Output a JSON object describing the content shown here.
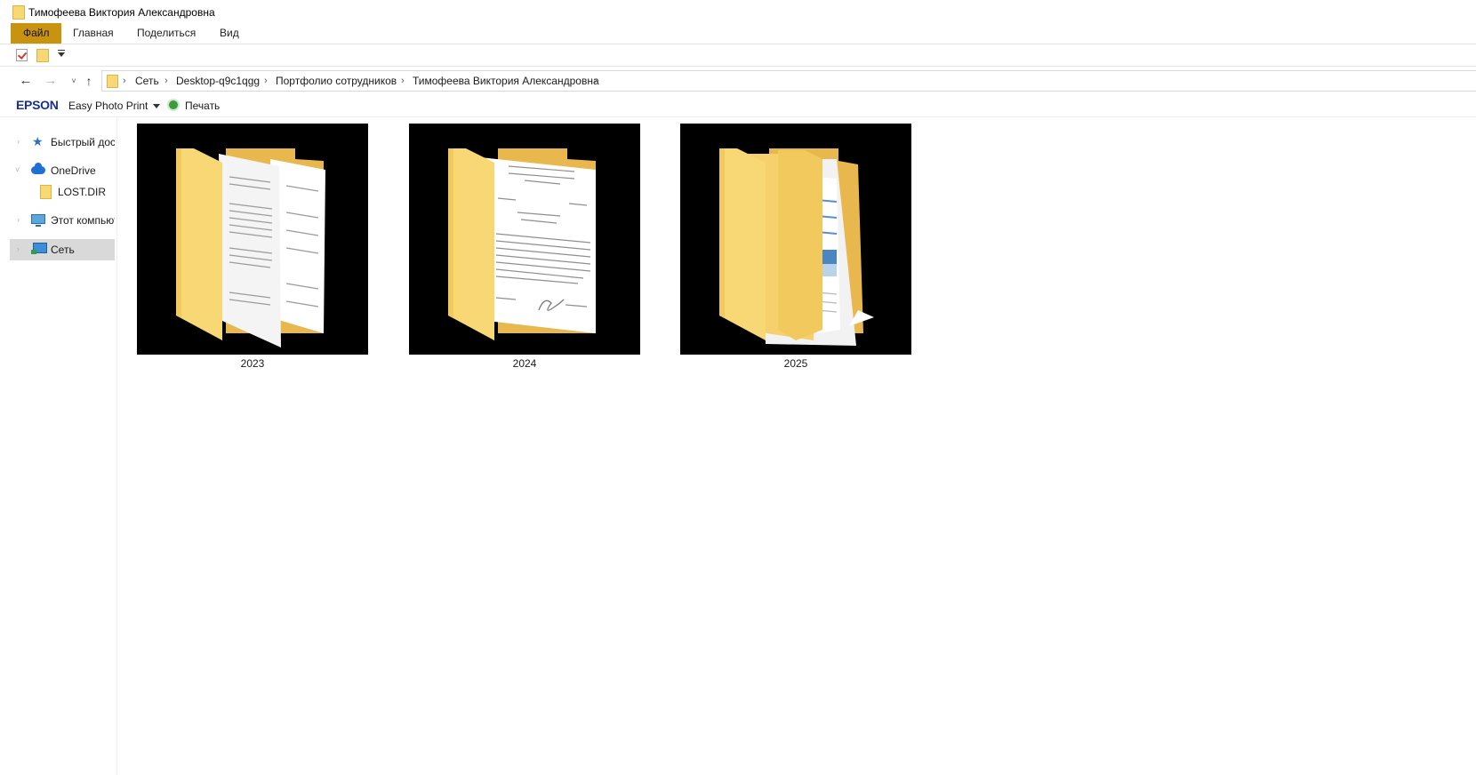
{
  "window": {
    "title": "Тимофеева Виктория Александровна"
  },
  "ribbon": {
    "tabs": [
      {
        "label": "Файл",
        "active": true
      },
      {
        "label": "Главная"
      },
      {
        "label": "Поделиться"
      },
      {
        "label": "Вид"
      }
    ]
  },
  "navigation": {
    "back": "←",
    "forward": "→",
    "recent": "˅",
    "up": "↑"
  },
  "address": {
    "breadcrumbs": [
      "Сеть",
      "Desktop-q9c1qgg",
      "Портфолио сотрудников",
      "Тимофеева Виктория Александровна"
    ],
    "separator": "›"
  },
  "epson": {
    "logo": "EPSON",
    "app": "Easy Photo Print",
    "print_label": "Печать"
  },
  "navpane": {
    "items": [
      {
        "label": "Быстрый доступ",
        "icon": "star-icon"
      },
      {
        "label": "OneDrive",
        "icon": "cloud-icon",
        "expanded": true
      },
      {
        "label": "LOST.DIR",
        "icon": "folder-icon"
      },
      {
        "label": "Этот компьютер",
        "icon": "computer-icon"
      },
      {
        "label": "Сеть",
        "icon": "network-icon",
        "selected": true
      }
    ],
    "chevron_collapsed": "›",
    "chevron_expanded": "˅"
  },
  "content": {
    "folders": [
      {
        "name": "2023",
        "preview": "documents"
      },
      {
        "name": "2024",
        "preview": "document"
      },
      {
        "name": "2025",
        "preview": "images"
      }
    ]
  },
  "colors": {
    "file_tab": "#c8930f",
    "folder": "#f8d775",
    "selection": "#d9d9d9"
  }
}
